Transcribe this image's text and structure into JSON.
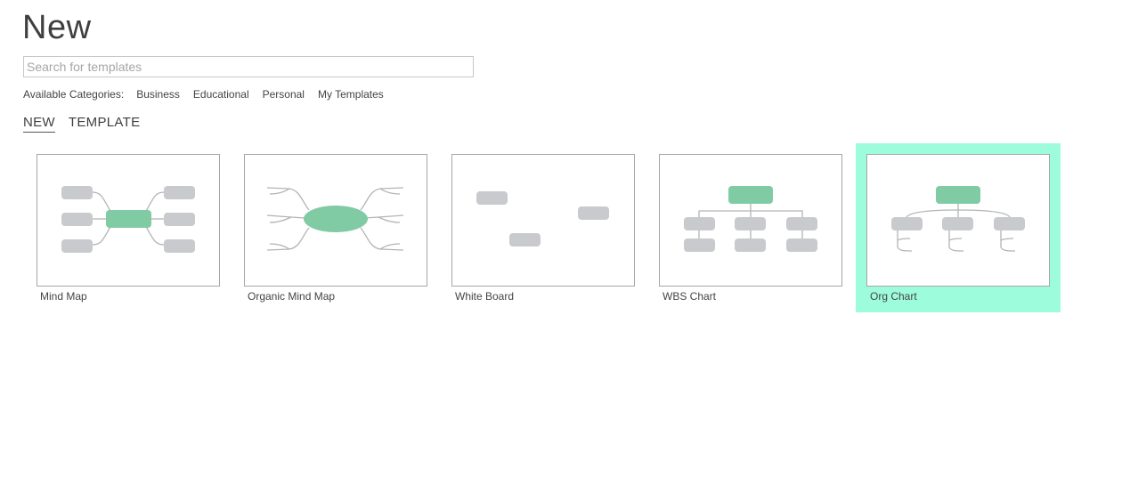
{
  "header": {
    "title": "New"
  },
  "search": {
    "placeholder": "Search for templates",
    "value": ""
  },
  "categories": {
    "label": "Available Categories:",
    "items": [
      "Business",
      "Educational",
      "Personal",
      "My Templates"
    ]
  },
  "tabs": [
    {
      "label": "NEW",
      "active": true
    },
    {
      "label": "TEMPLATE",
      "active": false
    }
  ],
  "templates": [
    {
      "label": "Mind Map",
      "icon": "mind-map-thumbnail",
      "selected": false
    },
    {
      "label": "Organic Mind Map",
      "icon": "organic-mind-map-thumbnail",
      "selected": false
    },
    {
      "label": "White Board",
      "icon": "white-board-thumbnail",
      "selected": false
    },
    {
      "label": "WBS Chart",
      "icon": "wbs-chart-thumbnail",
      "selected": false
    },
    {
      "label": "Org Chart",
      "icon": "org-chart-thumbnail",
      "selected": true
    }
  ],
  "colors": {
    "accent_green": "#80cba3",
    "node_gray": "#c9cacd",
    "connector_gray": "#b3b4b7",
    "selection_highlight": "#9dfcdc"
  }
}
